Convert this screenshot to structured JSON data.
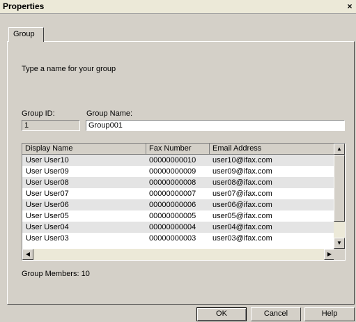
{
  "window": {
    "title": "Properties",
    "close_glyph": "×"
  },
  "tabs": [
    {
      "label": "Group"
    }
  ],
  "instruction": "Type a name for your group",
  "group_id": {
    "label": "Group ID:",
    "value": "1"
  },
  "group_name": {
    "label": "Group Name:",
    "value": "Group001"
  },
  "members_list": {
    "columns": [
      "Display Name",
      "Fax Number",
      "Email Address"
    ],
    "rows": [
      [
        "User User10",
        "00000000010",
        "user10@ifax.com"
      ],
      [
        "User User09",
        "00000000009",
        "user09@ifax.com"
      ],
      [
        "User User08",
        "00000000008",
        "user08@ifax.com"
      ],
      [
        "User User07",
        "00000000007",
        "user07@ifax.com"
      ],
      [
        "User User06",
        "00000000006",
        "user06@ifax.com"
      ],
      [
        "User User05",
        "00000000005",
        "user05@ifax.com"
      ],
      [
        "User User04",
        "00000000004",
        "user04@ifax.com"
      ],
      [
        "User User03",
        "00000000003",
        "user03@ifax.com"
      ]
    ]
  },
  "member_count": "Group Members: 10",
  "buttons": {
    "ok": "OK",
    "cancel": "Cancel",
    "help": "Help"
  },
  "colors": {
    "dialog_bg": "#d4d0c8",
    "row_alt": "#e4e4e4",
    "title_bg": "#ece9d8"
  }
}
